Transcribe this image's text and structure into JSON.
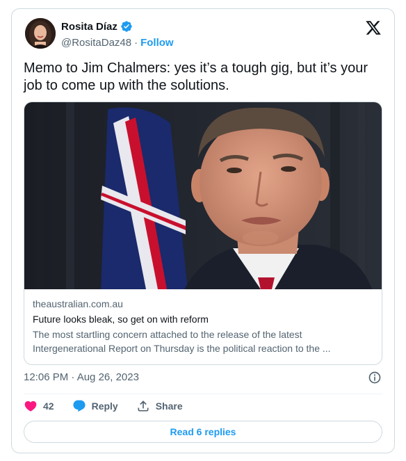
{
  "author": {
    "display_name": "Rosita Díaz",
    "handle": "@RositaDaz48",
    "separator": "·",
    "follow_label": "Follow"
  },
  "tweet": {
    "text": "Memo to Jim Chalmers: yes it’s a tough gig, but it’s your job to come up with the solutions."
  },
  "link_card": {
    "domain": "theaustralian.com.au",
    "title": "Future looks bleak, so get on with reform",
    "description": "The most startling concern attached to the release of the latest Intergenerational Report on Thursday is the political reaction to the ..."
  },
  "meta": {
    "timestamp": "12:06 PM · Aug 26, 2023"
  },
  "actions": {
    "like_count": "42",
    "reply_label": "Reply",
    "share_label": "Share"
  },
  "replies_button_label": "Read 6 replies",
  "colors": {
    "accent": "#1d9bf0",
    "like": "#f91880",
    "text_primary": "#0f1419",
    "text_secondary": "#536471",
    "border": "#cfd9de"
  },
  "icons": [
    "verified-badge-icon",
    "x-logo-icon",
    "info-icon",
    "heart-icon",
    "reply-bubble-icon",
    "share-icon"
  ]
}
